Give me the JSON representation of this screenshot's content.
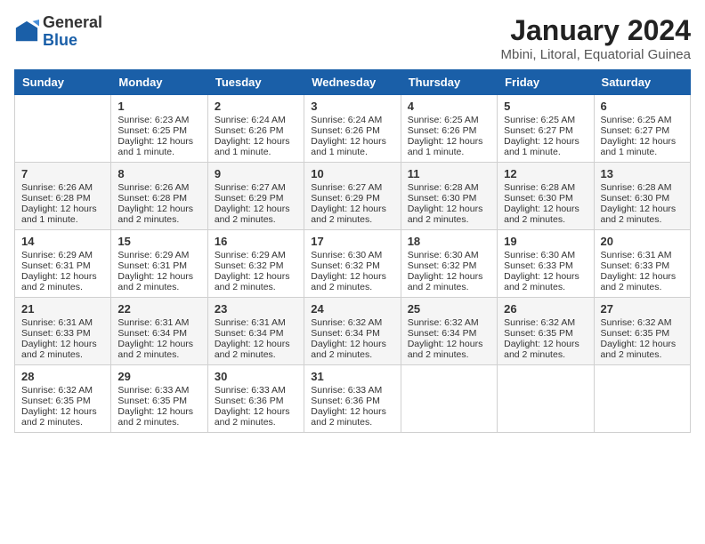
{
  "header": {
    "logo_general": "General",
    "logo_blue": "Blue",
    "title": "January 2024",
    "subtitle": "Mbini, Litoral, Equatorial Guinea"
  },
  "calendar": {
    "days_of_week": [
      "Sunday",
      "Monday",
      "Tuesday",
      "Wednesday",
      "Thursday",
      "Friday",
      "Saturday"
    ],
    "weeks": [
      [
        {
          "day": "",
          "content": ""
        },
        {
          "day": "1",
          "content": "Sunrise: 6:23 AM\nSunset: 6:25 PM\nDaylight: 12 hours and 1 minute."
        },
        {
          "day": "2",
          "content": "Sunrise: 6:24 AM\nSunset: 6:26 PM\nDaylight: 12 hours and 1 minute."
        },
        {
          "day": "3",
          "content": "Sunrise: 6:24 AM\nSunset: 6:26 PM\nDaylight: 12 hours and 1 minute."
        },
        {
          "day": "4",
          "content": "Sunrise: 6:25 AM\nSunset: 6:26 PM\nDaylight: 12 hours and 1 minute."
        },
        {
          "day": "5",
          "content": "Sunrise: 6:25 AM\nSunset: 6:27 PM\nDaylight: 12 hours and 1 minute."
        },
        {
          "day": "6",
          "content": "Sunrise: 6:25 AM\nSunset: 6:27 PM\nDaylight: 12 hours and 1 minute."
        }
      ],
      [
        {
          "day": "7",
          "content": "Sunrise: 6:26 AM\nSunset: 6:28 PM\nDaylight: 12 hours and 1 minute."
        },
        {
          "day": "8",
          "content": "Sunrise: 6:26 AM\nSunset: 6:28 PM\nDaylight: 12 hours and 2 minutes."
        },
        {
          "day": "9",
          "content": "Sunrise: 6:27 AM\nSunset: 6:29 PM\nDaylight: 12 hours and 2 minutes."
        },
        {
          "day": "10",
          "content": "Sunrise: 6:27 AM\nSunset: 6:29 PM\nDaylight: 12 hours and 2 minutes."
        },
        {
          "day": "11",
          "content": "Sunrise: 6:28 AM\nSunset: 6:30 PM\nDaylight: 12 hours and 2 minutes."
        },
        {
          "day": "12",
          "content": "Sunrise: 6:28 AM\nSunset: 6:30 PM\nDaylight: 12 hours and 2 minutes."
        },
        {
          "day": "13",
          "content": "Sunrise: 6:28 AM\nSunset: 6:30 PM\nDaylight: 12 hours and 2 minutes."
        }
      ],
      [
        {
          "day": "14",
          "content": "Sunrise: 6:29 AM\nSunset: 6:31 PM\nDaylight: 12 hours and 2 minutes."
        },
        {
          "day": "15",
          "content": "Sunrise: 6:29 AM\nSunset: 6:31 PM\nDaylight: 12 hours and 2 minutes."
        },
        {
          "day": "16",
          "content": "Sunrise: 6:29 AM\nSunset: 6:32 PM\nDaylight: 12 hours and 2 minutes."
        },
        {
          "day": "17",
          "content": "Sunrise: 6:30 AM\nSunset: 6:32 PM\nDaylight: 12 hours and 2 minutes."
        },
        {
          "day": "18",
          "content": "Sunrise: 6:30 AM\nSunset: 6:32 PM\nDaylight: 12 hours and 2 minutes."
        },
        {
          "day": "19",
          "content": "Sunrise: 6:30 AM\nSunset: 6:33 PM\nDaylight: 12 hours and 2 minutes."
        },
        {
          "day": "20",
          "content": "Sunrise: 6:31 AM\nSunset: 6:33 PM\nDaylight: 12 hours and 2 minutes."
        }
      ],
      [
        {
          "day": "21",
          "content": "Sunrise: 6:31 AM\nSunset: 6:33 PM\nDaylight: 12 hours and 2 minutes."
        },
        {
          "day": "22",
          "content": "Sunrise: 6:31 AM\nSunset: 6:34 PM\nDaylight: 12 hours and 2 minutes."
        },
        {
          "day": "23",
          "content": "Sunrise: 6:31 AM\nSunset: 6:34 PM\nDaylight: 12 hours and 2 minutes."
        },
        {
          "day": "24",
          "content": "Sunrise: 6:32 AM\nSunset: 6:34 PM\nDaylight: 12 hours and 2 minutes."
        },
        {
          "day": "25",
          "content": "Sunrise: 6:32 AM\nSunset: 6:34 PM\nDaylight: 12 hours and 2 minutes."
        },
        {
          "day": "26",
          "content": "Sunrise: 6:32 AM\nSunset: 6:35 PM\nDaylight: 12 hours and 2 minutes."
        },
        {
          "day": "27",
          "content": "Sunrise: 6:32 AM\nSunset: 6:35 PM\nDaylight: 12 hours and 2 minutes."
        }
      ],
      [
        {
          "day": "28",
          "content": "Sunrise: 6:32 AM\nSunset: 6:35 PM\nDaylight: 12 hours and 2 minutes."
        },
        {
          "day": "29",
          "content": "Sunrise: 6:33 AM\nSunset: 6:35 PM\nDaylight: 12 hours and 2 minutes."
        },
        {
          "day": "30",
          "content": "Sunrise: 6:33 AM\nSunset: 6:36 PM\nDaylight: 12 hours and 2 minutes."
        },
        {
          "day": "31",
          "content": "Sunrise: 6:33 AM\nSunset: 6:36 PM\nDaylight: 12 hours and 2 minutes."
        },
        {
          "day": "",
          "content": ""
        },
        {
          "day": "",
          "content": ""
        },
        {
          "day": "",
          "content": ""
        }
      ]
    ]
  }
}
